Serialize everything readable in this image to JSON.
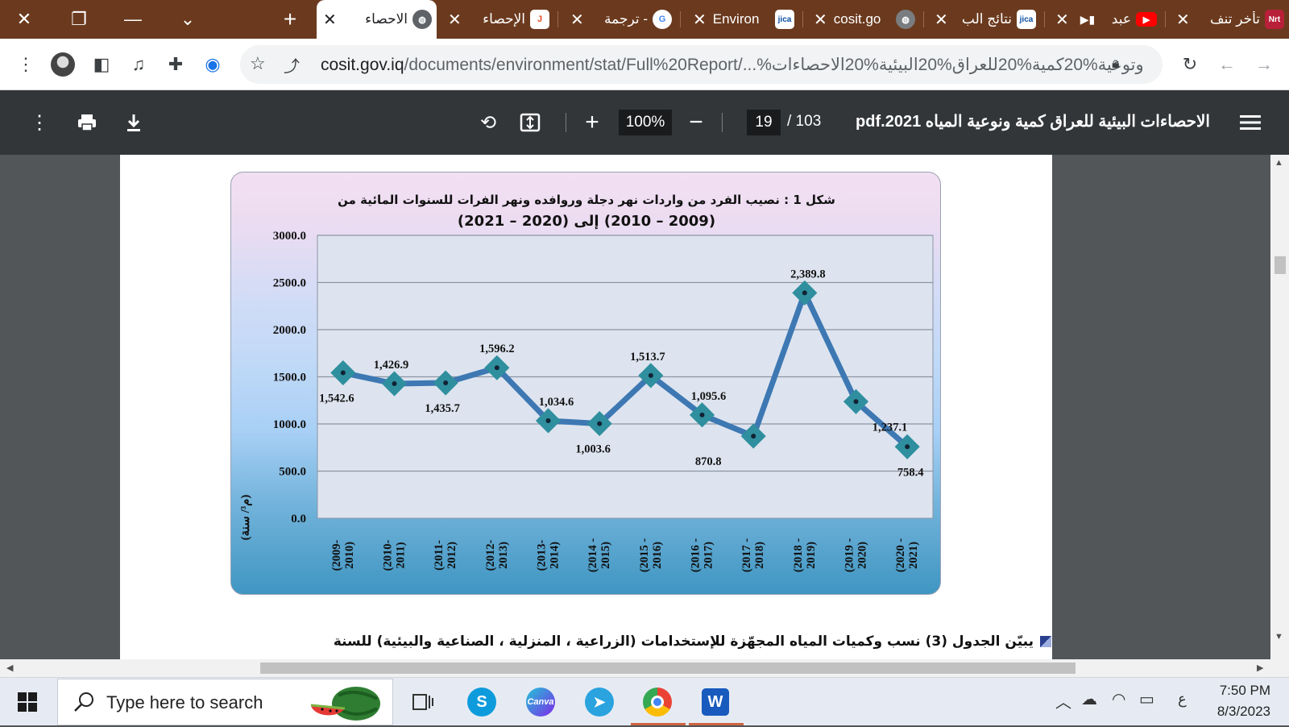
{
  "browser": {
    "tabs": [
      {
        "title": "تأخر تنف",
        "favicon": "nrt-icon",
        "favicon_text": "Nrt"
      },
      {
        "title": "عبد",
        "favicon": "youtube-icon",
        "favicon_text": "▶"
      },
      {
        "title": "نتائج الب",
        "favicon": "jica-icon",
        "favicon_text": "jica"
      },
      {
        "title": "cosit.go",
        "favicon": "globe-icon",
        "favicon_text": ""
      },
      {
        "title": "Environ",
        "favicon": "jica-icon",
        "favicon_text": "jica"
      },
      {
        "title": "ترجمة -",
        "favicon": "google-icon",
        "favicon_text": "G"
      },
      {
        "title": "الإحصاء",
        "favicon": "joomla-icon",
        "favicon_text": "J"
      },
      {
        "title": "الاحصاء",
        "favicon": "globe-icon",
        "favicon_text": "",
        "active": true
      }
    ],
    "url_host": "cosit.gov.iq",
    "url_path": "/documents/environment/stat/Full%20Report/...%وتوعية%20كمية%20للعراق%20البيئية%20الاحصاءات"
  },
  "pdf": {
    "title": "الاحصاءات البيئية للعراق كمية ونوعية المياه 2021.pdf",
    "page": "19",
    "page_total": "/ 103",
    "zoom": "100%"
  },
  "page_text": {
    "caption": "يبيّن الجدول (3) نسب وكميات المياه المجهّزة للإستخدامات (الزراعية ، المنزلية ، الصناعية والبيئية) للسنة"
  },
  "chart_data": {
    "type": "line",
    "title_line1": "شكل 1 : نصيب الفرد من واردات نهر دجلة وروافده ونهر الفرات للسنوات المائية من",
    "title_line2": "(2009 – 2010) إلى (2020 – 2021)",
    "ylabel": "(م³/ سنة)",
    "xlabel": "",
    "ylim": [
      0,
      3000
    ],
    "yticks": [
      "0.0",
      "500.0",
      "1000.0",
      "1500.0",
      "2000.0",
      "2500.0",
      "3000.0"
    ],
    "categories": [
      "(2009-\n2010)",
      "(2010-\n2011)",
      "(2011-\n2012)",
      "(2012-\n2013)",
      "(2013-\n2014)",
      "(2014 -\n2015)",
      "(2015 -\n2016)",
      "(2016 -\n2017)",
      "(2017 -\n2018)",
      "(2018 -\n2019)",
      "(2019 -\n2020)",
      "(2020 -\n2021)"
    ],
    "values": [
      1542.6,
      1426.9,
      1435.7,
      1596.2,
      1034.6,
      1003.6,
      1513.7,
      1095.6,
      870.8,
      2389.8,
      1237.1,
      758.4
    ],
    "value_labels": [
      "1,542.6",
      "1,426.9",
      "1,435.7",
      "1,596.2",
      "1,034.6",
      "1,003.6",
      "1,513.7",
      "1,095.6",
      "870.8",
      "2,389.8",
      "1,237.1",
      "758.4"
    ],
    "grid": true,
    "line_color": "#3d78b3",
    "marker_color": "#2f8f9e"
  },
  "taskbar": {
    "search_placeholder": "Type here to search",
    "time": "7:50 PM",
    "date": "8/3/2023",
    "lang": "ع"
  }
}
